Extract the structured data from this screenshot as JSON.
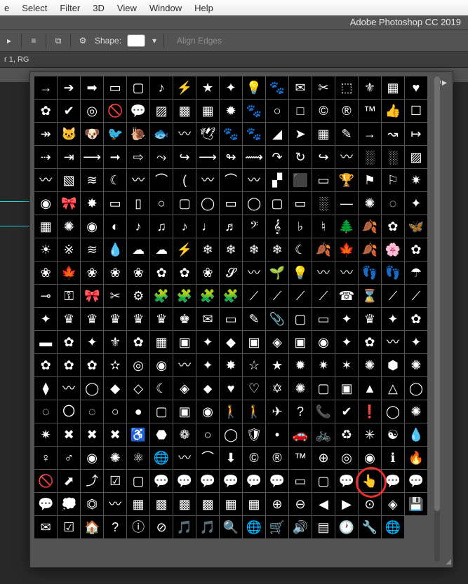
{
  "menubar": [
    "e",
    "Select",
    "Filter",
    "3D",
    "View",
    "Window",
    "Help"
  ],
  "app_title": "Adobe Photoshop CC 2019",
  "option_bar": {
    "shape_label": "Shape:",
    "align_edges": "Align Edges"
  },
  "doc_tab": "r 1, RG",
  "highlight_index": 303,
  "shapes": [
    "→",
    "➔",
    "➡",
    "▭",
    "▢",
    "♪",
    "⚡",
    "★",
    "✦",
    "💡",
    "🐾",
    "✉",
    "✂",
    "⬚",
    "⚜",
    "▦",
    "♥",
    "✿",
    "✔",
    "◎",
    "🚫",
    "💬",
    "▨",
    "▩",
    "▦",
    "✹",
    "🐾",
    "○",
    "□",
    "©",
    "®",
    "™",
    "👍",
    "☐",
    "↠",
    "🐱",
    "🐶",
    "🐦",
    "🐌",
    "🐟",
    "〰",
    "🕊",
    "🐾",
    "🐾",
    "◢",
    "➤",
    "▦",
    "✎",
    "→",
    "↝",
    "↦",
    "⇢",
    "⇥",
    "⟶",
    "➞",
    "⇨",
    "⤳",
    "↪",
    "⟶",
    "↬",
    "⟿",
    "↷",
    "↻",
    "↪",
    "〰",
    "░",
    "░",
    "▨",
    "〰",
    "▧",
    "≋",
    "☾",
    "〰",
    "⌒",
    "(",
    "〰",
    "⌒",
    "〰",
    "▞",
    "⬛",
    "▭",
    "🏆",
    "⚑",
    "⚐",
    "✷",
    "◉",
    "🎀",
    "✸",
    "▭",
    "▯",
    "○",
    "▢",
    "◯",
    "▭",
    "◯",
    "▢",
    "▭",
    "░",
    "—",
    "✺",
    "◌",
    "✦",
    "▦",
    "✺",
    "◉",
    "◐",
    "♪",
    "♫",
    "♪",
    "♩",
    "♬",
    "𝄢",
    "𝄞",
    "♭",
    "♮",
    "🌲",
    "🍂",
    "✿",
    "🦋",
    "☀",
    "※",
    "≋",
    "💧",
    "☁",
    "☁",
    "⚡",
    "❄",
    "❄",
    "❄",
    "❄",
    "☾",
    "🍂",
    "🍁",
    "🍂",
    "🌸",
    "✿",
    "❀",
    "🍁",
    "❀",
    "❀",
    "❀",
    "✿",
    "✿",
    "❀",
    "𝓢",
    "〰",
    "🌱",
    "💡",
    "〰",
    "〰",
    "👣",
    "👣",
    "☂",
    "⊸",
    "⚿",
    "🎀",
    "✂",
    "⚙",
    "🧩",
    "🧩",
    "🧩",
    "🧩",
    "⟋",
    "⟋",
    "⟋",
    "⟋",
    "☎",
    "⌛",
    "⟋",
    "⟋",
    "✦",
    "♛",
    "♛",
    "♛",
    "♛",
    "♛",
    "♚",
    "✉",
    "▭",
    "✎",
    "📎",
    "▢",
    "▭",
    "✦",
    "♛",
    "✦",
    "✿",
    "▬",
    "✿",
    "✦",
    "⚜",
    "✿",
    "▦",
    "▣",
    "✦",
    "◆",
    "▣",
    "◈",
    "▣",
    "◉",
    "✦",
    "✿",
    "〰",
    "✦",
    "✿",
    "✿",
    "✿",
    "✫",
    "◎",
    "◉",
    "〰",
    "✦",
    "✸",
    "☆",
    "★",
    "✹",
    "✷",
    "✶",
    "✺",
    "⬢",
    "✺",
    "⧫",
    "〰",
    "◯",
    "◆",
    "◇",
    "☾",
    "◈",
    "⬥",
    "♥",
    "♡",
    "✡",
    "✺",
    "▢",
    "▣",
    "▲",
    "△",
    "◯",
    "◌",
    "〇",
    "◌",
    "○",
    "●",
    "▢",
    "▣",
    "◉",
    "🚶",
    "🚶",
    "✈",
    "?",
    "📞",
    "✔",
    "❗",
    "◯",
    "✺",
    "✷",
    "✖",
    "✖",
    "✖",
    "♿",
    "⬣",
    "❁",
    "○",
    "◯",
    "🛡",
    "•",
    "🚗",
    "🚲",
    "♻",
    "✳",
    "☯",
    "💧",
    "♀",
    "♂",
    "◉",
    "✺",
    "⚛",
    "🌐",
    "〰",
    "⌒",
    "⬇",
    "©",
    "®",
    "™",
    "⊕",
    "◎",
    "◉",
    "ℹ",
    "🔥",
    "🚫",
    "⬈",
    "⤴",
    "☑",
    "▢",
    "💬",
    "💬",
    "💬",
    "💬",
    "💬",
    "💬",
    "▭",
    "▢",
    "💬",
    "👆",
    "💬",
    "💬",
    "💬",
    "💭",
    "⏣",
    "〰",
    "▦",
    "▩",
    "▩",
    "▩",
    "▦",
    "▦",
    "⊕",
    "⊖",
    "◀",
    "▶",
    "⊙",
    "◈",
    "💾",
    "✉",
    "☑",
    "🏠",
    "?",
    "ⓘ",
    "⊘",
    "🎵",
    "🎵",
    "🔍",
    "🌐",
    "🛒",
    "🔊",
    "▤",
    "🕐",
    "🔧",
    "🌐"
  ]
}
